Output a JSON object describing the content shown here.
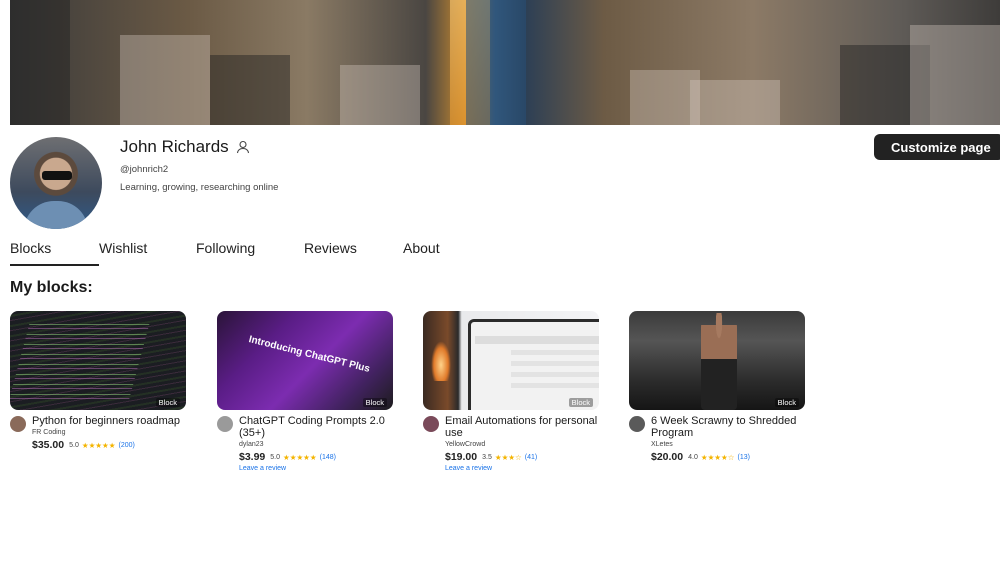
{
  "profile": {
    "name": "John Richards",
    "handle": "@johnrich2",
    "bio": "Learning, growing, researching online",
    "customize_label": "Customize page"
  },
  "tabs": [
    {
      "label": "Blocks",
      "active": true
    },
    {
      "label": "Wishlist",
      "active": false
    },
    {
      "label": "Following",
      "active": false
    },
    {
      "label": "Reviews",
      "active": false
    },
    {
      "label": "About",
      "active": false
    }
  ],
  "section_title": "My blocks:",
  "cards": [
    {
      "title": "Python for beginners roadmap",
      "seller": "FR Coding",
      "price": "$35.00",
      "rating": "5.0",
      "stars": "★★★★★",
      "reviews": "(200)",
      "tag": "Block",
      "review_link": "",
      "avatar_color": "#8a6a5a"
    },
    {
      "title": "ChatGPT Coding Prompts 2.0 (35+)",
      "seller": "dylan23",
      "price": "$3.99",
      "rating": "5.0",
      "stars": "★★★★★",
      "reviews": "(148)",
      "tag": "Block",
      "review_link": "Leave a review",
      "avatar_color": "#9a9a9a"
    },
    {
      "title": "Email Automations for personal use",
      "seller": "YellowCrowd",
      "price": "$19.00",
      "rating": "3.5",
      "stars": "★★★☆",
      "reviews": "(41)",
      "tag": "Block",
      "review_link": "Leave a review",
      "avatar_color": "#7a4a5a"
    },
    {
      "title": "6 Week Scrawny to Shredded Program",
      "seller": "XLetes",
      "price": "$20.00",
      "rating": "4.0",
      "stars": "★★★★☆",
      "reviews": "(13)",
      "tag": "Block",
      "review_link": "",
      "avatar_color": "#5a5a5a"
    }
  ],
  "thumb_text": {
    "chatgpt": "Introducing ChatGPT Plus"
  },
  "colors": {
    "accent_dark": "#222222",
    "star": "#f4b400",
    "link": "#1a73e8"
  }
}
